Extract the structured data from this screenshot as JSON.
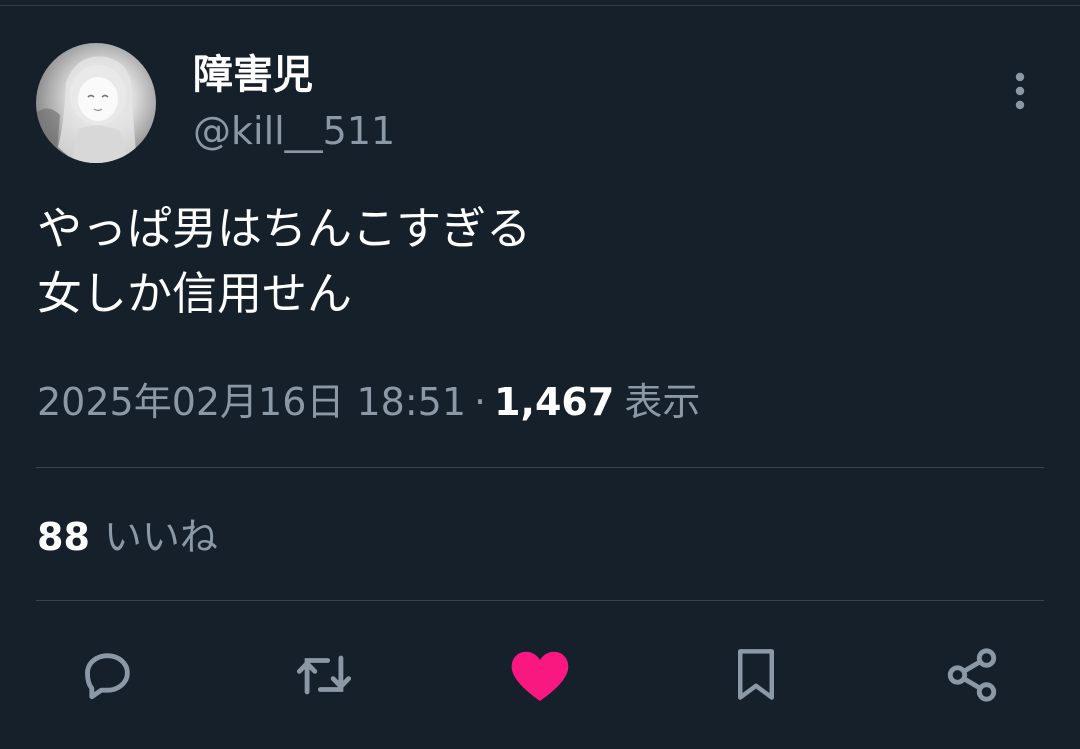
{
  "user": {
    "display_name": "障害児",
    "handle": "@kill__511"
  },
  "tweet": {
    "lines": [
      "やっぱ男はちんこすぎる",
      "女しか信用せん"
    ],
    "timestamp": "2025年02月16日 18:51",
    "separator": "·",
    "views_count": "1,467",
    "views_label": "表示"
  },
  "engagement": {
    "likes_count": "88",
    "likes_label": "いいね"
  },
  "actions": {
    "liked": true,
    "icons": [
      "reply-icon",
      "retweet-icon",
      "heart-icon",
      "bookmark-icon",
      "share-icon"
    ]
  },
  "colors": {
    "background": "#15202b",
    "primary_text": "#ffffff",
    "secondary_text": "#8b98a5",
    "like_active": "#f91880",
    "divider": "#38444d"
  }
}
